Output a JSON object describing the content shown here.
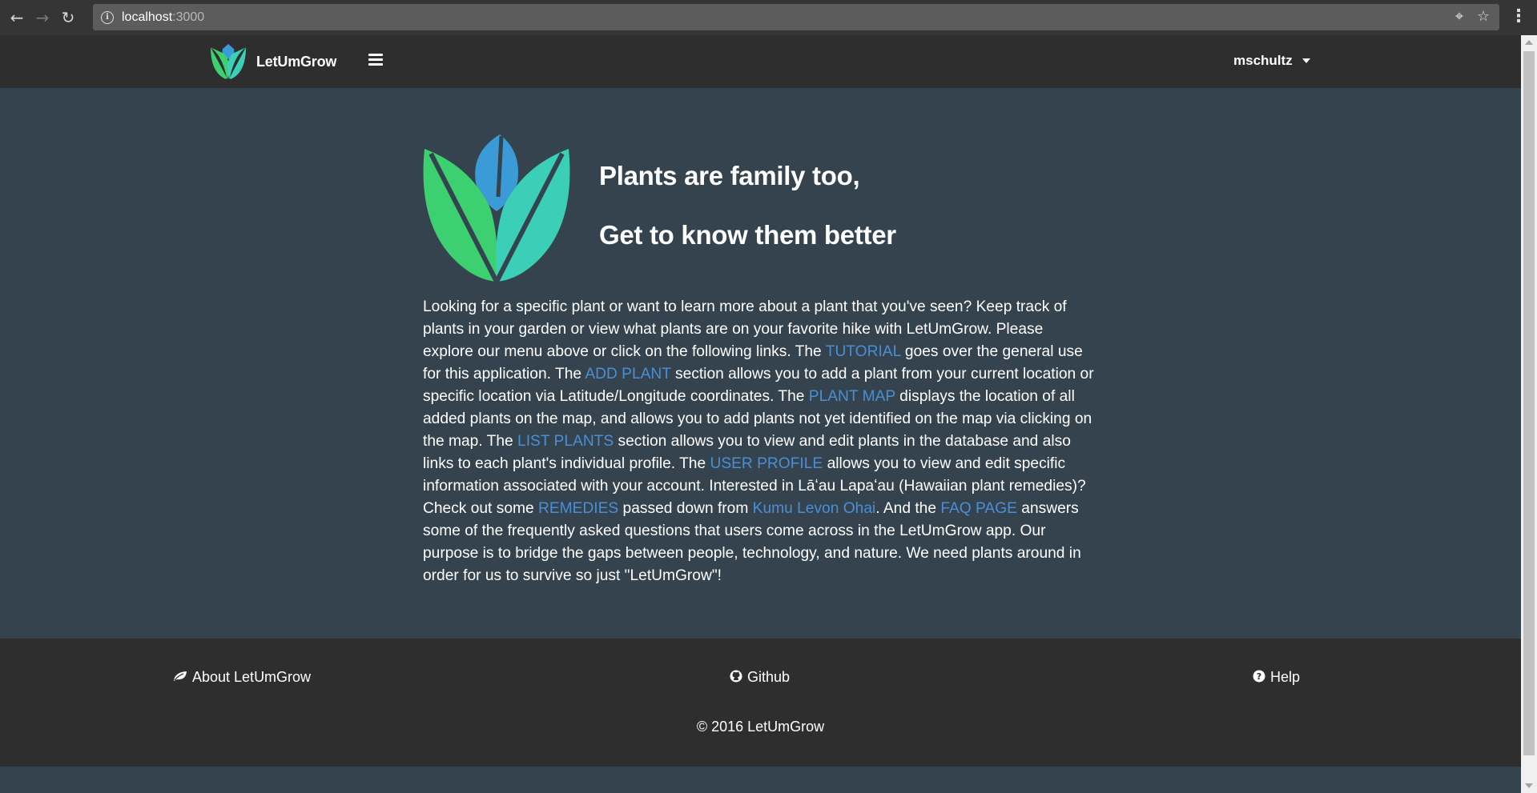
{
  "browser": {
    "url_host": "localhost",
    "url_port": ":3000",
    "back_icon": "arrow-left-icon",
    "forward_icon": "arrow-right-icon",
    "reload_icon": "reload-icon"
  },
  "header": {
    "brand_name": "LetUmGrow",
    "user_name": "mschultz"
  },
  "hero": {
    "title_line1": "Plants are family too,",
    "title_line2": "Get to know them better"
  },
  "intro": {
    "t1": "Looking for a specific plant or want to learn more about a plant that you've seen? Keep track of plants in your garden or view what plants are on your favorite hike with LetUmGrow. Please explore our menu above or click on the following links. The ",
    "link_tutorial": "TUTORIAL",
    "t2": " goes over the general use for this application. The ",
    "link_add_plant": "ADD PLANT",
    "t3": " section allows you to add a plant from your current location or specific location via Latitude/Longitude coordinates. The ",
    "link_plant_map": "PLANT MAP",
    "t4": " displays the location of all added plants on the map, and allows you to add plants not yet identified on the map via clicking on the map. The ",
    "link_list_plants": "LIST PLANTS",
    "t5": " section allows you to view and edit plants in the database and also links to each plant's individual profile. The ",
    "link_user_profile": "USER PROFILE",
    "t6": " allows you to view and edit specific information associated with your account. Interested in Lāʻau Lapaʻau (Hawaiian plant remedies)? Check out some ",
    "link_remedies": "REMEDIES",
    "t7": " passed down from ",
    "link_kumu": "Kumu Levon Ohai",
    "t8": ". And the ",
    "link_faq": "FAQ PAGE",
    "t9": " answers some of the frequently asked questions that users come across in the LetUmGrow app. Our purpose is to bridge the gaps between people, technology, and nature. We need plants around in order for us to survive so just \"LetUmGrow\"!"
  },
  "footer": {
    "about_label": "About LetUmGrow",
    "github_label": "Github",
    "help_label": "Help",
    "copyright": "© 2016 LetUmGrow"
  },
  "colors": {
    "header_bg": "#2e2e2e",
    "main_bg": "#34434e",
    "link": "#4a8fd6",
    "leaf_green": "#3cd070",
    "leaf_teal": "#3ccfb8",
    "leaf_blue": "#3b9bd6"
  }
}
